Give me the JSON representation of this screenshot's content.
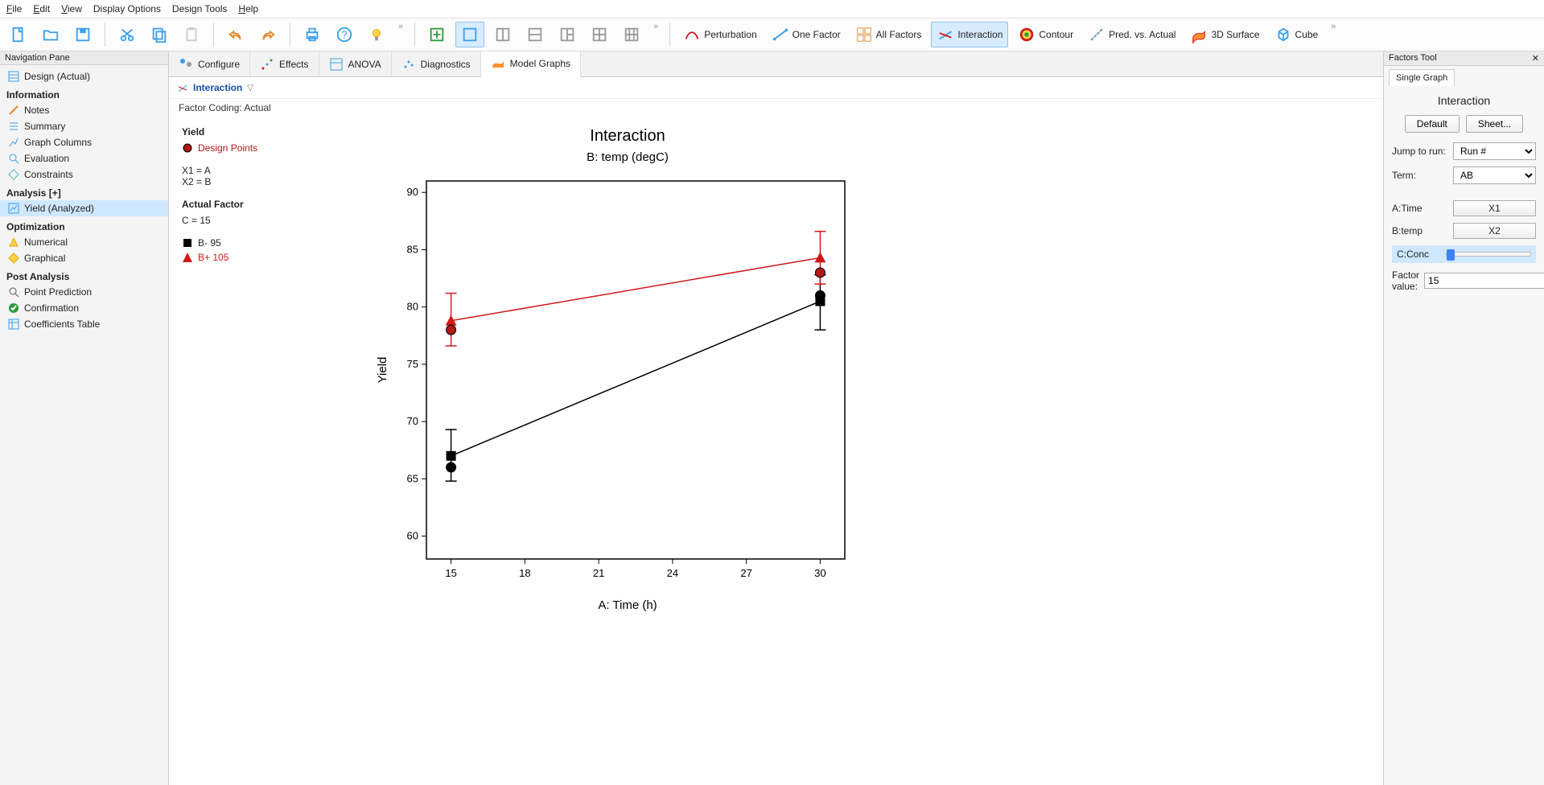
{
  "menu": [
    "File",
    "Edit",
    "View",
    "Display Options",
    "Design Tools",
    "Help"
  ],
  "toolbar_graphs": {
    "perturbation": "Perturbation",
    "one_factor": "One Factor",
    "all_factors": "All Factors",
    "interaction": "Interaction",
    "contour": "Contour",
    "pred_vs_actual": "Pred. vs. Actual",
    "surface": "3D Surface",
    "cube": "Cube"
  },
  "nav": {
    "pane_title": "Navigation Pane",
    "design": "Design (Actual)",
    "info_header": "Information",
    "notes": "Notes",
    "summary": "Summary",
    "graph_columns": "Graph Columns",
    "evaluation": "Evaluation",
    "constraints": "Constraints",
    "analysis_header": "Analysis [+]",
    "yield": "Yield (Analyzed)",
    "optimization_header": "Optimization",
    "numerical": "Numerical",
    "graphical": "Graphical",
    "post_analysis_header": "Post Analysis",
    "point_prediction": "Point Prediction",
    "confirmation": "Confirmation",
    "coefficients": "Coefficients Table"
  },
  "main_tabs": {
    "configure": "Configure",
    "effects": "Effects",
    "anova": "ANOVA",
    "diagnostics": "Diagnostics",
    "model_graphs": "Model Graphs"
  },
  "sub": {
    "title": "Interaction",
    "coding": "Factor Coding: Actual"
  },
  "legend": {
    "response": "Yield",
    "design_points": "Design Points",
    "x1": "X1 = A",
    "x2": "X2 = B",
    "actual_header": "Actual Factor",
    "actual": "C = 15",
    "bminus": "B-  95",
    "bplus": "B+  105"
  },
  "factors": {
    "title": "Factors Tool",
    "tab": "Single Graph",
    "heading": "Interaction",
    "default": "Default",
    "sheet": "Sheet...",
    "jump_label": "Jump to run:",
    "jump_value": "Run #",
    "term_label": "Term:",
    "term_value": "AB",
    "a_label": "A:Time",
    "a_val": "X1",
    "b_label": "B:temp",
    "b_val": "X2",
    "c_label": "C:Conc",
    "factor_value_label": "Factor value:",
    "factor_value": "15"
  },
  "chart_data": {
    "type": "line",
    "title": "Interaction",
    "subtitle": "B: temp (degC)",
    "xlabel": "A: Time (h)",
    "ylabel": "Yield",
    "x": [
      15,
      30
    ],
    "x_ticks": [
      15,
      18,
      21,
      24,
      27,
      30
    ],
    "y_ticks": [
      60,
      65,
      70,
      75,
      80,
      85,
      90
    ],
    "ylim": [
      58,
      91
    ],
    "xlim": [
      14,
      31
    ],
    "series": [
      {
        "name": "B- 95",
        "color": "#000000",
        "marker": "square",
        "values": [
          67,
          80.5
        ],
        "err_low": [
          64.8,
          78.0
        ],
        "err_high": [
          69.3,
          82.8
        ]
      },
      {
        "name": "B+ 105",
        "color": "#d11919",
        "marker": "triangle",
        "values": [
          78.8,
          84.3
        ],
        "err_low": [
          76.6,
          82.0
        ],
        "err_high": [
          81.2,
          86.6
        ]
      }
    ],
    "design_points": [
      {
        "x": 15,
        "y": 78.0,
        "color": "#d11919"
      },
      {
        "x": 15,
        "y": 66.0,
        "color": "#000000"
      },
      {
        "x": 30,
        "y": 83.0,
        "color": "#d11919"
      },
      {
        "x": 30,
        "y": 81.0,
        "color": "#000000"
      }
    ]
  }
}
